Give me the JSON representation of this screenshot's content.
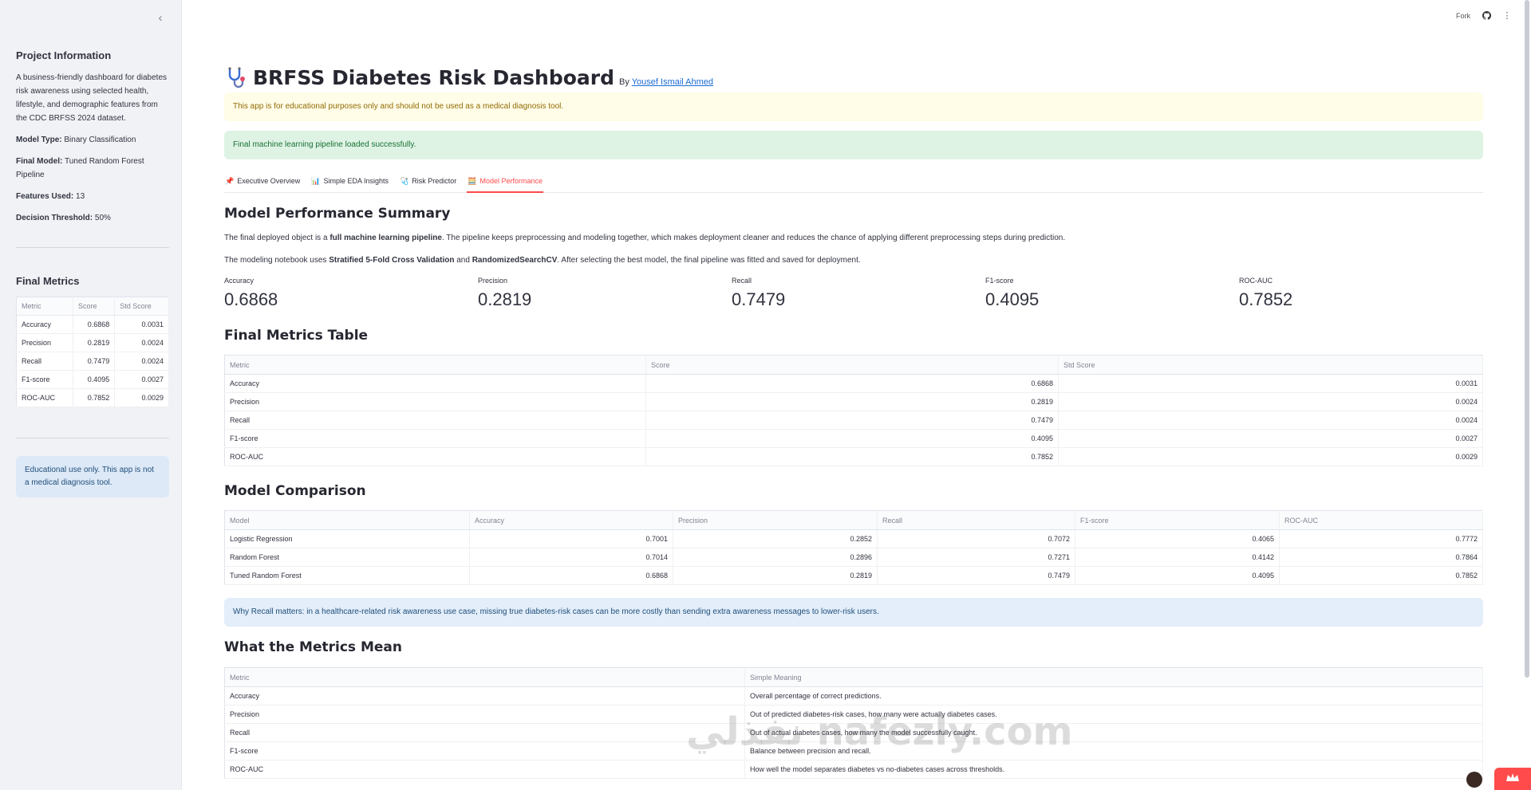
{
  "sidebar": {
    "collapse_icon": "‹",
    "project_heading": "Project Information",
    "description": "A business-friendly dashboard for diabetes risk awareness using selected health, lifestyle, and demographic features from the CDC BRFSS 2024 dataset.",
    "model_type_label": "Model Type:",
    "model_type_value": "Binary Classification",
    "final_model_label": "Final Model:",
    "final_model_value": "Tuned Random Forest Pipeline",
    "features_label": "Features Used:",
    "features_value": "13",
    "threshold_label": "Decision Threshold:",
    "threshold_value": "50%",
    "metrics_heading": "Final Metrics",
    "metrics_table": {
      "headers": [
        "Metric",
        "Score",
        "Std Score"
      ],
      "rows": [
        [
          "Accuracy",
          "0.6868",
          "0.0031"
        ],
        [
          "Precision",
          "0.2819",
          "0.0024"
        ],
        [
          "Recall",
          "0.7479",
          "0.0024"
        ],
        [
          "F1-score",
          "0.4095",
          "0.0027"
        ],
        [
          "ROC-AUC",
          "0.7852",
          "0.0029"
        ]
      ]
    },
    "info_note": "Educational use only. This app is not a medical diagnosis tool."
  },
  "header": {
    "fork_label": "Fork",
    "github_icon": "github-icon",
    "menu_icon": "⋮"
  },
  "page": {
    "title": "BRFSS Diabetes Risk Dashboard",
    "by_label": "By",
    "author": "Yousef Ismail Ahmed",
    "warning": "This app is for educational purposes only and should not be used as a medical diagnosis tool.",
    "success": "Final machine learning pipeline loaded successfully."
  },
  "tabs": [
    {
      "icon": "📌",
      "label": "Executive Overview"
    },
    {
      "icon": "📊",
      "label": "Simple EDA Insights"
    },
    {
      "icon": "🩺",
      "label": "Risk Predictor"
    },
    {
      "icon": "🧮",
      "label": "Model Performance"
    }
  ],
  "performance": {
    "summary_heading": "Model Performance Summary",
    "para1_a": "The final deployed object is a ",
    "para1_b": "full machine learning pipeline",
    "para1_c": ". The pipeline keeps preprocessing and modeling together, which makes deployment cleaner and reduces the chance of applying different preprocessing steps during prediction.",
    "para2_a": "The modeling notebook uses ",
    "para2_b": "Stratified 5-Fold Cross Validation",
    "para2_c": " and ",
    "para2_d": "RandomizedSearchCV",
    "para2_e": ". After selecting the best model, the final pipeline was fitted and saved for deployment.",
    "metrics": [
      {
        "label": "Accuracy",
        "value": "0.6868"
      },
      {
        "label": "Precision",
        "value": "0.2819"
      },
      {
        "label": "Recall",
        "value": "0.7479"
      },
      {
        "label": "F1-score",
        "value": "0.4095"
      },
      {
        "label": "ROC-AUC",
        "value": "0.7852"
      }
    ],
    "final_table_heading": "Final Metrics Table",
    "final_table": {
      "headers": [
        "Metric",
        "Score",
        "Std Score"
      ],
      "rows": [
        [
          "Accuracy",
          "0.6868",
          "0.0031"
        ],
        [
          "Precision",
          "0.2819",
          "0.0024"
        ],
        [
          "Recall",
          "0.7479",
          "0.0024"
        ],
        [
          "F1-score",
          "0.4095",
          "0.0027"
        ],
        [
          "ROC-AUC",
          "0.7852",
          "0.0029"
        ]
      ]
    },
    "comparison_heading": "Model Comparison",
    "comparison_table": {
      "headers": [
        "Model",
        "Accuracy",
        "Precision",
        "Recall",
        "F1-score",
        "ROC-AUC"
      ],
      "rows": [
        [
          "Logistic Regression",
          "0.7001",
          "0.2852",
          "0.7072",
          "0.4065",
          "0.7772"
        ],
        [
          "Random Forest",
          "0.7014",
          "0.2896",
          "0.7271",
          "0.4142",
          "0.7864"
        ],
        [
          "Tuned Random Forest",
          "0.6868",
          "0.2819",
          "0.7479",
          "0.4095",
          "0.7852"
        ]
      ]
    },
    "recall_note": "Why Recall matters: in a healthcare-related risk awareness use case, missing true diabetes-risk cases can be more costly than sending extra awareness messages to lower-risk users.",
    "meaning_heading": "What the Metrics Mean",
    "meaning_table": {
      "headers": [
        "Metric",
        "Simple Meaning"
      ],
      "rows": [
        [
          "Accuracy",
          "Overall percentage of correct predictions."
        ],
        [
          "Precision",
          "Out of predicted diabetes-risk cases, how many were actually diabetes cases."
        ],
        [
          "Recall",
          "Out of actual diabetes cases, how many the model successfully caught."
        ],
        [
          "F1-score",
          "Balance between precision and recall."
        ],
        [
          "ROC-AUC",
          "How well the model separates diabetes vs no-diabetes cases across thresholds."
        ]
      ]
    }
  },
  "watermark": "نفذلي nafezly.com",
  "colors": {
    "accent": "#ff4b4b",
    "sidebar_bg": "#f0f2f6",
    "warning_bg": "#fffce7",
    "success_bg": "#dff3e5",
    "info_bg": "#e3eefa"
  }
}
